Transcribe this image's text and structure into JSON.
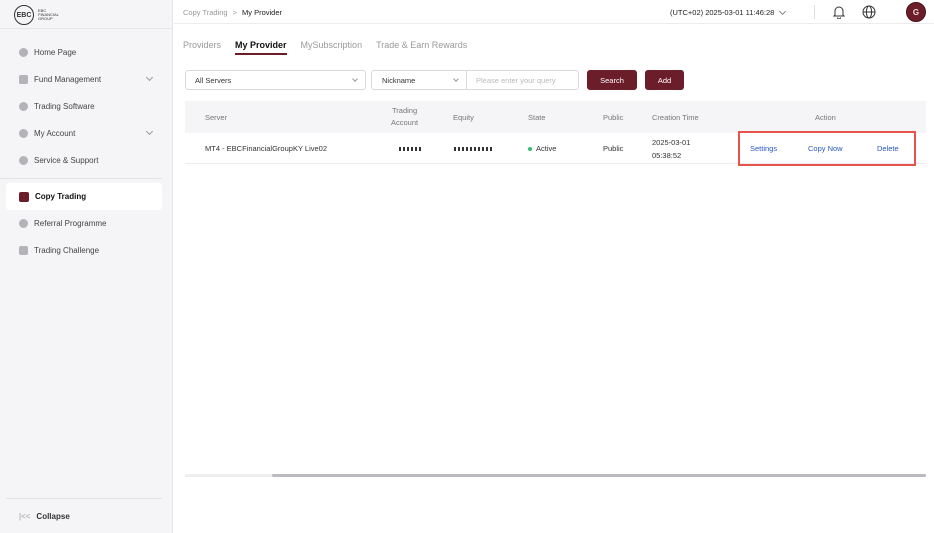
{
  "brand": {
    "logo_mark": "EBC",
    "logo_line1": "EBC",
    "logo_line2": "FINANCIAL",
    "logo_line3": "GROUP"
  },
  "sidebar": {
    "items": [
      {
        "label": "Home Page",
        "icon": "home-icon"
      },
      {
        "label": "Fund Management",
        "icon": "wallet-icon"
      },
      {
        "label": "Trading Software",
        "icon": "software-icon"
      },
      {
        "label": "My Account",
        "icon": "user-icon"
      },
      {
        "label": "Service & Support",
        "icon": "support-icon"
      },
      {
        "label": "Copy Trading",
        "icon": "copy-trading-icon"
      },
      {
        "label": "Referral Programme",
        "icon": "referral-icon"
      },
      {
        "label": "Trading Challenge",
        "icon": "trophy-icon"
      }
    ],
    "collapse_label": "Collapse"
  },
  "header": {
    "breadcrumb_parent": "Copy Trading",
    "breadcrumb_sep": ">",
    "breadcrumb_current": "My Provider",
    "clock": "(UTC+02)  2025-03-01 11:46:28",
    "avatar_letter": "G"
  },
  "tabs": [
    "Providers",
    "My Provider",
    "MySubscription",
    "Trade & Earn Rewards"
  ],
  "filters": {
    "server_value": "All Servers",
    "field_value": "Nickname",
    "query_placeholder": "Please enter your query",
    "search_label": "Search",
    "add_label": "Add"
  },
  "table": {
    "headers": {
      "server": "Server",
      "account_line1": "Trading",
      "account_line2": "Account",
      "equity": "Equity",
      "state": "State",
      "public": "Public",
      "created": "Creation Time",
      "action": "Action"
    },
    "rows": [
      {
        "server": "MT4 - EBCFinancialGroupKY Live02",
        "state": "Active",
        "public": "Public",
        "created_date": "2025-03-01",
        "created_time": "05:38:52",
        "actions": {
          "settings": "Settings",
          "copy": "Copy Now",
          "delete": "Delete"
        }
      }
    ]
  },
  "colors": {
    "accent": "#6b1d2a",
    "link": "#2a57c4",
    "active_dot": "#2fbf71",
    "highlight": "#e5534b"
  }
}
